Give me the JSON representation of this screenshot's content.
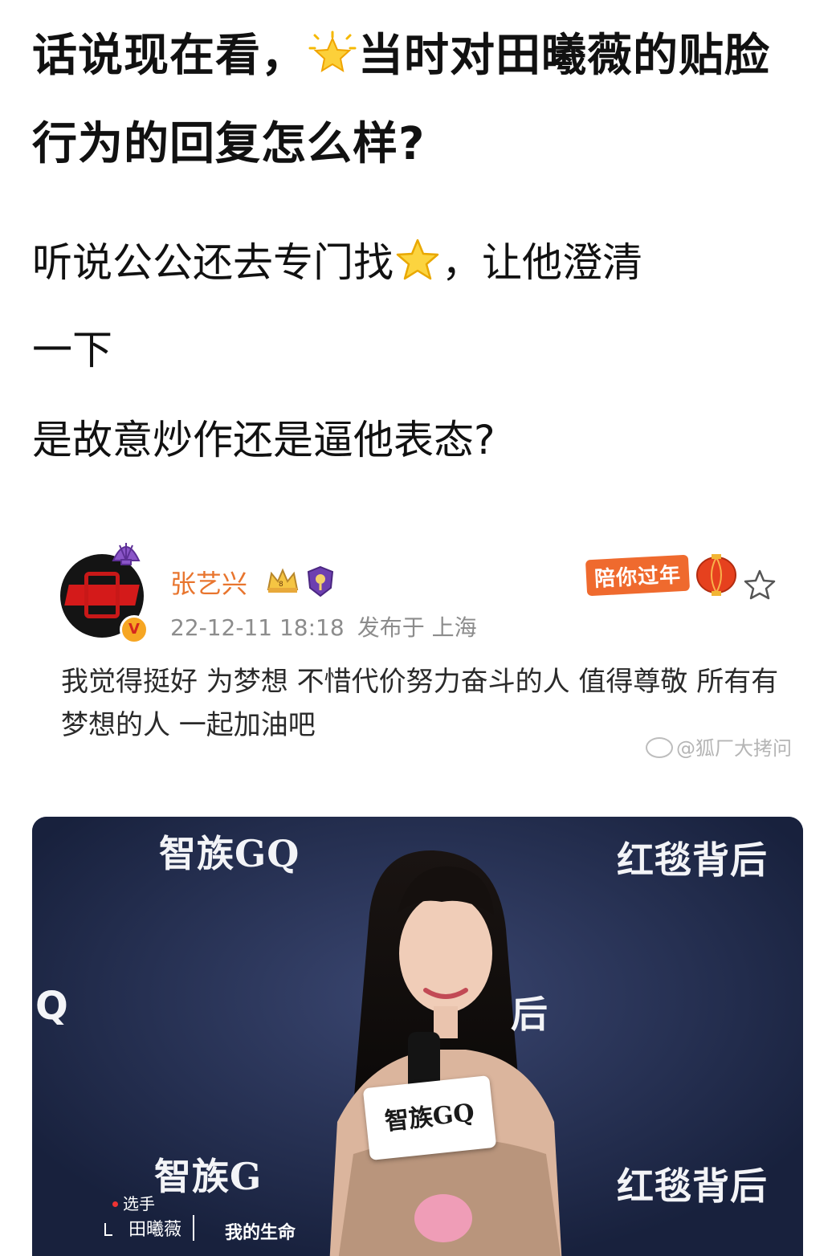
{
  "post": {
    "title_part1": "话说现在看，",
    "title_part2": "当时对田曦薇的贴脸行为的回复怎么样?",
    "title_emoji": "glowing-star-emoji",
    "line1_part1": "听说公公还去专门找",
    "line1_part2": "，让他澄清",
    "line1_emoji": "star-emoji",
    "line2": "一下",
    "line3": "是故意炒作还是逼他表态?"
  },
  "embedded_weibo": {
    "user_name": "张艺兴",
    "timestamp": "22-12-11 18:18",
    "published_at": "发布于 上海",
    "badge_text": "陪你过年",
    "verified_mark": "V",
    "content": "我觉得挺好 为梦想 不惜代价努力奋斗的人 值得尊敬 所有有梦想的人 一起加油吧",
    "watermark": "@狐厂大拷问",
    "icons": [
      "shell-icon",
      "crown-icon",
      "rank-badge-icon",
      "lantern-icon",
      "star-outline-icon"
    ]
  },
  "photo": {
    "wall_text_1": "智族GQ",
    "wall_text_2": "红毯背后",
    "wall_text_3": "智族G",
    "wall_text_4": "红毯背后",
    "wall_text_5": "Q",
    "wall_text_6": "后",
    "mic_card": "智族GQ",
    "caption_role": "选手",
    "caption_name": "田曦薇",
    "caption_song": "我的生命"
  },
  "colors": {
    "username": "#e8752e",
    "meta_gray": "#8c8c8c",
    "photo_bg": "#1f2a4a",
    "badge_orange": "#ef6a2e"
  }
}
